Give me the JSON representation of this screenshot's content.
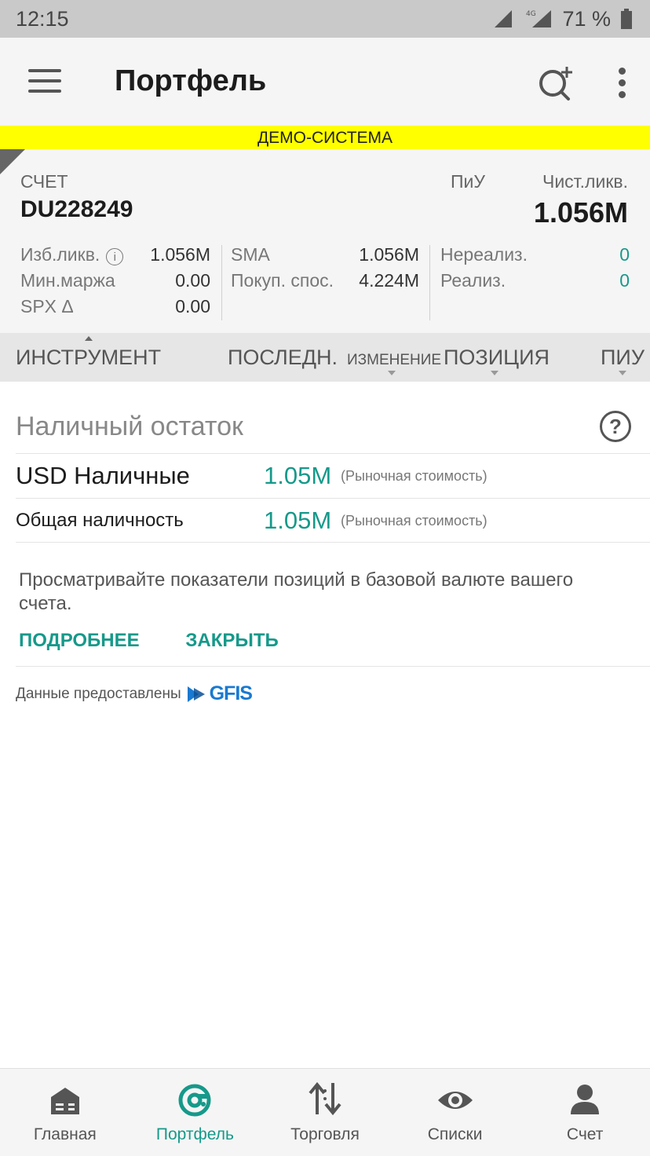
{
  "status_bar": {
    "time": "12:15",
    "network": "4G",
    "battery": "71 %"
  },
  "app_bar": {
    "title": "Портфель"
  },
  "banner": {
    "text": "ДЕМО-СИСТЕМА"
  },
  "account": {
    "label": "СЧЕТ",
    "id": "DU228249",
    "piu_label": "ПиУ",
    "net_liq_label": "Чист.ликв.",
    "net_liq_value": "1.056M",
    "metrics": {
      "col1": [
        {
          "label": "Изб.ликв.",
          "value": "1.056M",
          "info": "i"
        },
        {
          "label": "Мин.маржа",
          "value": "0.00"
        },
        {
          "label": "SPX Δ",
          "value": "0.00"
        }
      ],
      "col2": [
        {
          "label": "SMA",
          "value": "1.056M"
        },
        {
          "label": "Покуп. спос.",
          "value": "4.224M"
        }
      ],
      "col3": [
        {
          "label": "Нереализ.",
          "value": "0"
        },
        {
          "label": "Реализ.",
          "value": "0"
        }
      ]
    }
  },
  "columns": {
    "instrument": "ИНСТРУМЕНТ",
    "last": "ПОСЛЕДН.",
    "change": "ИЗМЕНЕНИЕ",
    "position": "ПОЗИЦИЯ",
    "piu": "ПИУ"
  },
  "cash": {
    "title": "Наличный остаток",
    "help": "?",
    "rows": [
      {
        "label": "USD Наличные",
        "amount": "1.05M",
        "note": "(Рыночная стоимость)"
      },
      {
        "label": "Общая наличность",
        "amount": "1.05M",
        "note": "(Рыночная стоимость)"
      }
    ]
  },
  "tip": {
    "text": "Просматривайте показатели позиций в базовой валюте вашего счета.",
    "more": "ПОДРОБНЕЕ",
    "close": "ЗАКРЫТЬ"
  },
  "provider": {
    "text": "Данные предоставлены",
    "logo": "GFIS"
  },
  "colors": {
    "accent": "#16998a",
    "banner": "#ffff00",
    "logo": "#1979d1"
  },
  "nav": [
    {
      "label": "Главная",
      "icon": "home-icon"
    },
    {
      "label": "Портфель",
      "icon": "portfolio-icon",
      "active": true
    },
    {
      "label": "Торговля",
      "icon": "trade-arrows-icon"
    },
    {
      "label": "Списки",
      "icon": "eye-icon"
    },
    {
      "label": "Счет",
      "icon": "account-person-icon"
    }
  ]
}
